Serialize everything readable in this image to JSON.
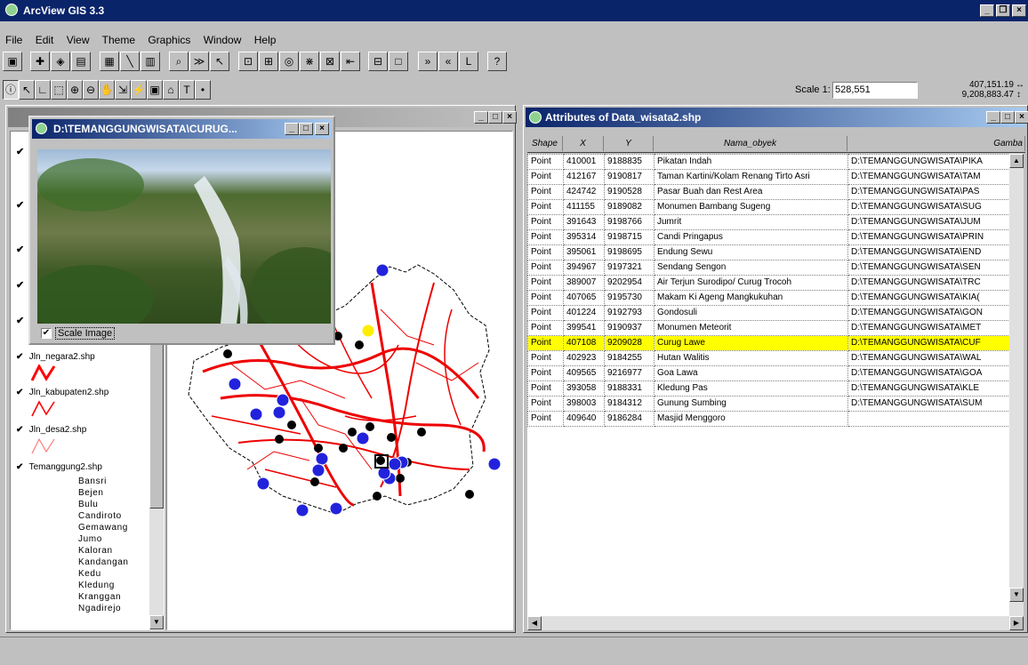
{
  "app": {
    "title": "ArcView GIS 3.3"
  },
  "menu": [
    "File",
    "Edit",
    "View",
    "Theme",
    "Graphics",
    "Window",
    "Help"
  ],
  "toolbar2": {
    "scale_label": "Scale 1:",
    "scale_value": "528,551",
    "coord_x": "407,151.19",
    "coord_y": "9,208,883.47"
  },
  "image_window": {
    "title": "D:\\TEMANGGUNGWISATA\\CURUG...",
    "scale_image_label": "Scale Image"
  },
  "view": {
    "legend": [
      {
        "name": "Jln_negara2.shp",
        "color": "#ff0000"
      },
      {
        "name": "Jln_kabupaten2.shp",
        "color": "#ff0000"
      },
      {
        "name": "Jln_desa2.shp",
        "color": "#ff6666"
      },
      {
        "name": "Temanggung2.shp",
        "color": "#000000"
      }
    ],
    "classes": [
      "Bansri",
      "Bejen",
      "Bulu",
      "Candiroto",
      "Gemawang",
      "Jumo",
      "Kaloran",
      "Kandangan",
      "Kedu",
      "Kledung",
      "Kranggan",
      "Ngadirejo"
    ]
  },
  "attr_window": {
    "title": "Attributes of Data_wisata2.shp",
    "columns": [
      "Shape",
      "X",
      "Y",
      "Nama_obyek",
      "Gamba"
    ],
    "rows": [
      [
        "Point",
        "410001",
        "9188835",
        "Pikatan Indah",
        "D:\\TEMANGGUNGWISATA\\PIKA"
      ],
      [
        "Point",
        "412167",
        "9190817",
        "Taman Kartini/Kolam Renang Tirto Asri",
        "D:\\TEMANGGUNGWISATA\\TAM"
      ],
      [
        "Point",
        "424742",
        "9190528",
        "Pasar Buah dan Rest Area",
        "D:\\TEMANGGUNGWISATA\\PAS"
      ],
      [
        "Point",
        "411155",
        "9189082",
        "Monumen Bambang Sugeng",
        "D:\\TEMANGGUNGWISATA\\SUG"
      ],
      [
        "Point",
        "391643",
        "9198766",
        "Jumrit",
        "D:\\TEMANGGUNGWISATA\\JUM"
      ],
      [
        "Point",
        "395314",
        "9198715",
        "Candi Pringapus",
        "D:\\TEMANGGUNGWISATA\\PRIN"
      ],
      [
        "Point",
        "395061",
        "9198695",
        "Endung Sewu",
        "D:\\TEMANGGUNGWISATA\\END"
      ],
      [
        "Point",
        "394967",
        "9197321",
        "Sendang Sengon",
        "D:\\TEMANGGUNGWISATA\\SEN"
      ],
      [
        "Point",
        "389007",
        "9202954",
        "Air Terjun Surodipo/ Curug Trocoh",
        "D:\\TEMANGGUNGWISATA\\TRC"
      ],
      [
        "Point",
        "407065",
        "9195730",
        "Makam Ki Ageng Mangkukuhan",
        "D:\\TEMANGGUNGWISATA\\KIA("
      ],
      [
        "Point",
        "401224",
        "9192793",
        "Gondosuli",
        "D:\\TEMANGGUNGWISATA\\GON"
      ],
      [
        "Point",
        "399541",
        "9190937",
        "Monumen Meteorit",
        "D:\\TEMANGGUNGWISATA\\MET"
      ],
      [
        "Point",
        "407108",
        "9209028",
        "Curug Lawe",
        "D:\\TEMANGGUNGWISATA\\CUF"
      ],
      [
        "Point",
        "402923",
        "9184255",
        "Hutan Walitis",
        "D:\\TEMANGGUNGWISATA\\WAL"
      ],
      [
        "Point",
        "409565",
        "9216977",
        "Goa Lawa",
        "D:\\TEMANGGUNGWISATA\\GOA"
      ],
      [
        "Point",
        "393058",
        "9188331",
        "Kledung Pas",
        "D:\\TEMANGGUNGWISATA\\KLE"
      ],
      [
        "Point",
        "398003",
        "9184312",
        "Gunung Sumbing",
        "D:\\TEMANGGUNGWISATA\\SUM"
      ],
      [
        "Point",
        "409640",
        "9186284",
        "Masjid Menggoro",
        ""
      ]
    ],
    "selected_row": 12
  }
}
